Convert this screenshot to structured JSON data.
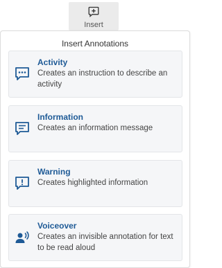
{
  "toolbar": {
    "insert_label": "Insert"
  },
  "panel": {
    "title": "Insert Annotations"
  },
  "items": [
    {
      "title": "Activity",
      "description": "Creates an instruction to describe an activity",
      "icon": "chat-dots-icon"
    },
    {
      "title": "Information",
      "description": "Creates an information message",
      "icon": "message-lines-icon"
    },
    {
      "title": "Warning",
      "description": "Creates highlighted information",
      "icon": "message-exclamation-icon"
    },
    {
      "title": "Voiceover",
      "description": "Creates an invisible annotation for text to be read aloud",
      "icon": "voice-user-icon"
    }
  ],
  "colors": {
    "accent": "#1e5a96",
    "card_bg": "#f5f6f8"
  }
}
